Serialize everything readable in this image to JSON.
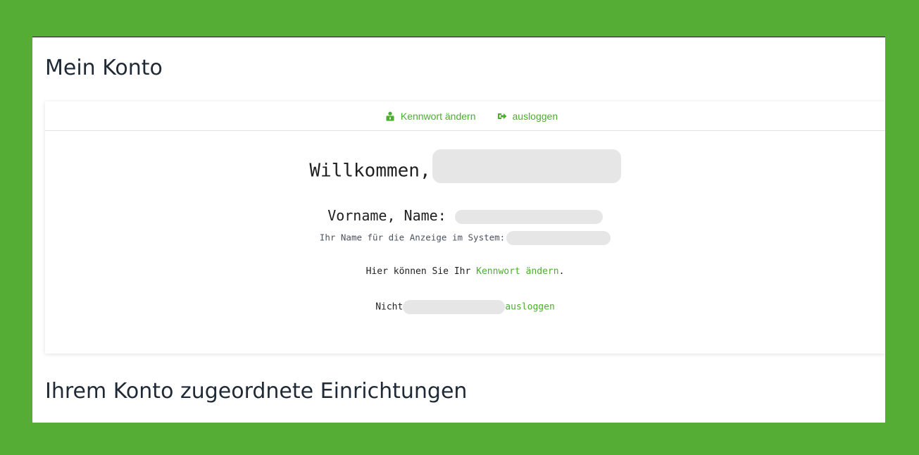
{
  "page": {
    "title": "Mein Konto",
    "section_title": "Ihrem Konto zugeordnete Einrichtungen"
  },
  "nav": {
    "change_password_label": "Kennwort ändern",
    "change_password_icon": "user-lock-icon",
    "logout_label": "ausloggen",
    "logout_icon": "sign-out-icon"
  },
  "account": {
    "welcome_prefix": "Willkommen,",
    "name_label": "Vorname, Name:",
    "display_name_label": "Ihr Name für die Anzeige im System:",
    "password_prefix": "Hier können Sie Ihr",
    "password_link": "Kennwort ändern",
    "password_suffix": ".",
    "logout_prefix": "Nicht",
    "logout_link": "ausloggen"
  },
  "colors": {
    "background": "#55ad35",
    "link": "#4cae2e",
    "heading": "#1f2a36"
  }
}
